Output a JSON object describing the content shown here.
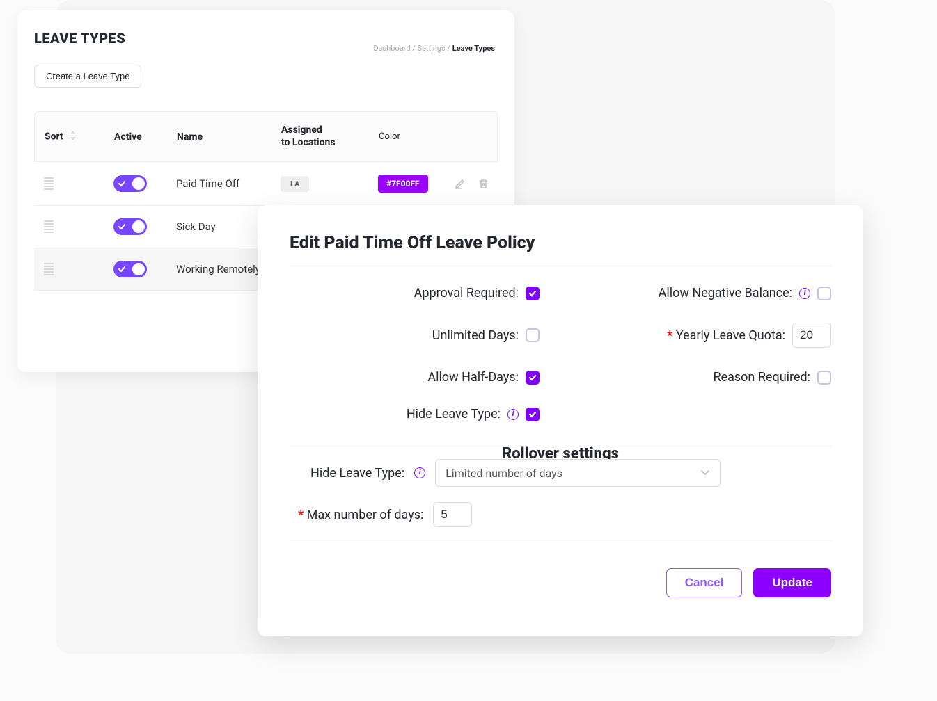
{
  "page": {
    "title": "LEAVE TYPES",
    "breadcrumb": [
      "Dashboard",
      "Settings",
      "Leave Types"
    ],
    "create_button": "Create a Leave Type"
  },
  "table": {
    "headers": {
      "sort": "Sort",
      "active": "Active",
      "name": "Name",
      "assigned": "Assigned to Locations",
      "color": "Color"
    },
    "rows": [
      {
        "name": "Paid Time Off",
        "active": true,
        "location": "LA",
        "color_code": "#7F00FF",
        "selected": false
      },
      {
        "name": "Sick Day",
        "active": true,
        "location": "",
        "color_code": "",
        "selected": false
      },
      {
        "name": "Working Remotely",
        "active": true,
        "location": "",
        "color_code": "",
        "selected": true
      }
    ]
  },
  "modal": {
    "title": "Edit Paid Time Off Leave Policy",
    "fields": {
      "approval_required": {
        "label": "Approval Required:",
        "checked": true
      },
      "unlimited_days": {
        "label": "Unlimited Days:",
        "checked": false
      },
      "allow_half_days": {
        "label": "Allow Half-Days:",
        "checked": true
      },
      "hide_leave_type": {
        "label": "Hide Leave Type:",
        "checked": true
      },
      "allow_negative": {
        "label": "Allow Negative Balance:",
        "checked": false
      },
      "yearly_quota": {
        "label": "Yearly Leave Quota:",
        "value": "20"
      },
      "reason_required": {
        "label": "Reason Required:",
        "checked": false
      }
    },
    "rollover": {
      "title": "Rollover settings",
      "hide_label": "Hide Leave Type:",
      "select_value": "Limited number of days",
      "max_days_label": "Max number of days:",
      "max_days_value": "5"
    },
    "buttons": {
      "cancel": "Cancel",
      "update": "Update"
    }
  }
}
